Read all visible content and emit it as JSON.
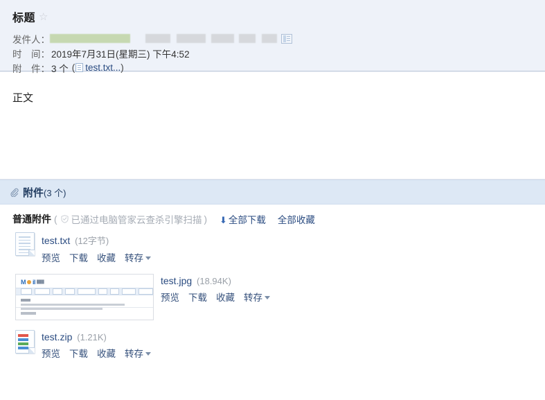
{
  "mail": {
    "subject": "标题",
    "star_icon": "star-outline-icon",
    "sender": {
      "label": "发件人：",
      "value_redacted": true,
      "contact_card_icon": "contact-card-icon"
    },
    "date": {
      "label": "时　间：",
      "value": "2019年7月31日(星期三) 下午4:52"
    },
    "attachment_summary": {
      "label": "附　件：",
      "count_text": "3 个",
      "paren_open": "(",
      "file_icon": "text-file-icon",
      "file_name": "test.txt...",
      "paren_close": ")"
    },
    "body_text": "正文"
  },
  "attachment_section": {
    "clip_icon": "paperclip-icon",
    "title": "附件",
    "count": "(3 个)",
    "subheader": {
      "group_label": "普通附件",
      "scan_paren_open": "(",
      "shield_icon": "shield-check-icon",
      "scan_text": "已通过电脑管家云查杀引擎扫描",
      "scan_paren_close": ")",
      "download_arrow_icon": "download-arrow-icon",
      "download_all": "全部下载",
      "favorite_all": "全部收藏"
    },
    "actions": {
      "preview": "预览",
      "download": "下载",
      "favorite": "收藏",
      "save_to": "转存",
      "caret_icon": "chevron-down-icon"
    },
    "items": [
      {
        "name": "test.txt",
        "size": "(12字节)",
        "icon": "text-file-icon",
        "thumbnail": false
      },
      {
        "name": "test.jpg",
        "size": "(18.94K)",
        "icon": "image-thumbnail",
        "thumbnail": true
      },
      {
        "name": "test.zip",
        "size": "(1.21K)",
        "icon": "zip-file-icon",
        "thumbnail": false
      }
    ]
  },
  "colors": {
    "header_bg": "#eef2f9",
    "attachment_bar_bg": "#dde8f5",
    "link": "#2a4b80",
    "action_link": "#36517c",
    "muted": "#9aa0a8",
    "redact_green": "#c6d8b1",
    "redact_gray": "#d6d8dc"
  }
}
